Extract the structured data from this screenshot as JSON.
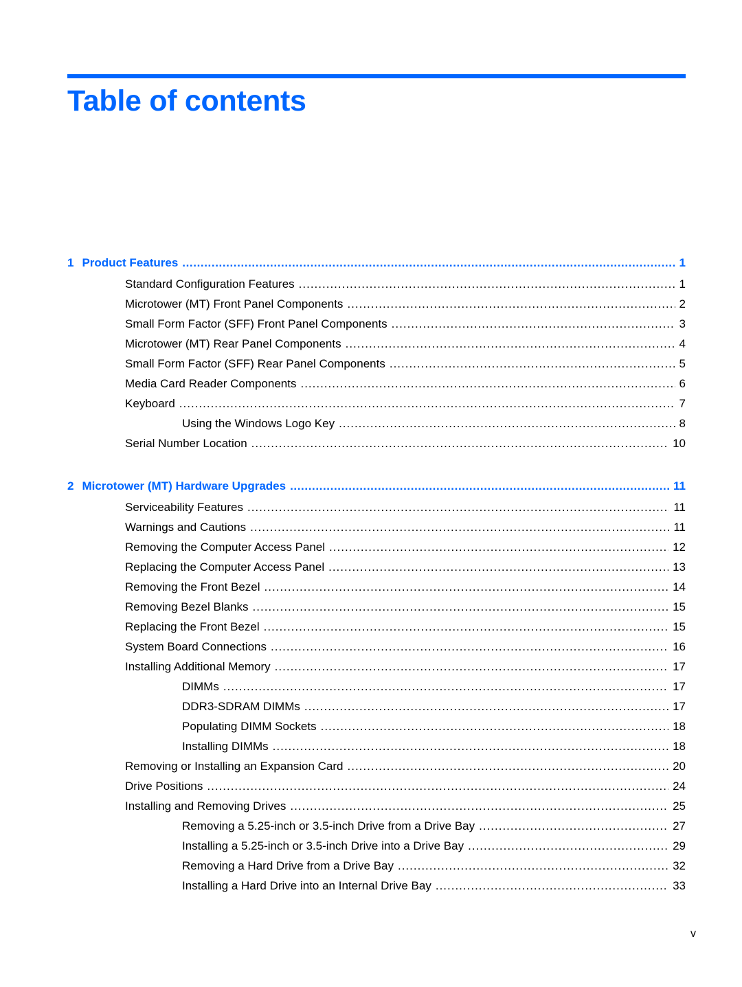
{
  "header": {
    "title": "Table of contents",
    "accent_color": "#0066ff"
  },
  "toc": [
    {
      "number": "1",
      "title": "Product Features",
      "page": "1",
      "entries": [
        {
          "title": "Standard Configuration Features",
          "page": "1",
          "level": 1
        },
        {
          "title": "Microtower (MT) Front Panel Components",
          "page": "2",
          "level": 1
        },
        {
          "title": "Small Form Factor (SFF) Front Panel Components",
          "page": "3",
          "level": 1
        },
        {
          "title": "Microtower (MT) Rear Panel Components",
          "page": "4",
          "level": 1
        },
        {
          "title": "Small Form Factor (SFF) Rear Panel Components",
          "page": "5",
          "level": 1
        },
        {
          "title": "Media Card Reader Components",
          "page": "6",
          "level": 1
        },
        {
          "title": "Keyboard",
          "page": "7",
          "level": 1
        },
        {
          "title": "Using the Windows Logo Key",
          "page": "8",
          "level": 2
        },
        {
          "title": "Serial Number Location",
          "page": "10",
          "level": 1
        }
      ]
    },
    {
      "number": "2",
      "title": "Microtower (MT) Hardware Upgrades",
      "page": "11",
      "entries": [
        {
          "title": "Serviceability Features",
          "page": "11",
          "level": 1
        },
        {
          "title": "Warnings and Cautions",
          "page": "11",
          "level": 1
        },
        {
          "title": "Removing the Computer Access Panel",
          "page": "12",
          "level": 1
        },
        {
          "title": "Replacing the Computer Access Panel",
          "page": "13",
          "level": 1
        },
        {
          "title": "Removing the Front Bezel",
          "page": "14",
          "level": 1
        },
        {
          "title": "Removing Bezel Blanks",
          "page": "15",
          "level": 1
        },
        {
          "title": "Replacing the Front Bezel",
          "page": "15",
          "level": 1
        },
        {
          "title": "System Board Connections",
          "page": "16",
          "level": 1
        },
        {
          "title": "Installing Additional Memory",
          "page": "17",
          "level": 1
        },
        {
          "title": "DIMMs",
          "page": "17",
          "level": 2
        },
        {
          "title": "DDR3-SDRAM DIMMs",
          "page": "17",
          "level": 2
        },
        {
          "title": "Populating DIMM Sockets",
          "page": "18",
          "level": 2
        },
        {
          "title": "Installing DIMMs",
          "page": "18",
          "level": 2
        },
        {
          "title": "Removing or Installing an Expansion Card",
          "page": "20",
          "level": 1
        },
        {
          "title": "Drive Positions",
          "page": "24",
          "level": 1
        },
        {
          "title": "Installing and Removing Drives",
          "page": "25",
          "level": 1
        },
        {
          "title": "Removing a 5.25-inch or 3.5-inch Drive from a Drive Bay",
          "page": "27",
          "level": 2
        },
        {
          "title": "Installing a 5.25-inch or 3.5-inch Drive into a Drive Bay",
          "page": "29",
          "level": 2
        },
        {
          "title": "Removing a Hard Drive from a Drive Bay",
          "page": "32",
          "level": 2
        },
        {
          "title": "Installing a Hard Drive into an Internal Drive Bay",
          "page": "33",
          "level": 2
        }
      ]
    }
  ],
  "footer": {
    "page_number": "v"
  }
}
